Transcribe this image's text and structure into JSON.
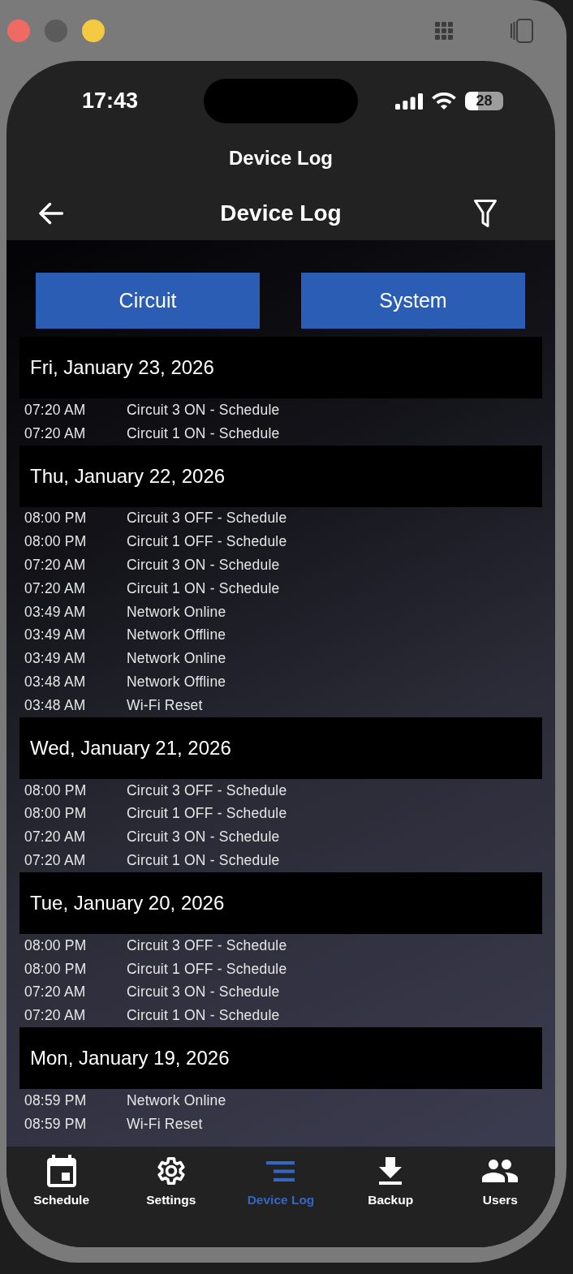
{
  "window": {
    "controls": [
      {
        "color": "#ee6a63"
      },
      {
        "color": "#5b5b5b"
      },
      {
        "color": "#f5c942"
      }
    ]
  },
  "status_bar": {
    "time": "17:43",
    "battery": "28"
  },
  "page_title": "Device Log",
  "nav_bar": {
    "title": "Device Log"
  },
  "categories": [
    {
      "label": "Circuit"
    },
    {
      "label": "System"
    }
  ],
  "log": [
    {
      "date": "Fri, January 23, 2026",
      "entries": [
        {
          "time": "07:20 AM",
          "event": "Circuit 3 ON - Schedule"
        },
        {
          "time": "07:20 AM",
          "event": "Circuit 1 ON - Schedule"
        }
      ]
    },
    {
      "date": "Thu, January 22, 2026",
      "entries": [
        {
          "time": "08:00 PM",
          "event": "Circuit 3 OFF - Schedule"
        },
        {
          "time": "08:00 PM",
          "event": "Circuit 1 OFF - Schedule"
        },
        {
          "time": "07:20 AM",
          "event": "Circuit 3 ON - Schedule"
        },
        {
          "time": "07:20 AM",
          "event": "Circuit 1 ON - Schedule"
        },
        {
          "time": "03:49 AM",
          "event": "Network Online"
        },
        {
          "time": "03:49 AM",
          "event": "Network Offline"
        },
        {
          "time": "03:49 AM",
          "event": "Network Online"
        },
        {
          "time": "03:48 AM",
          "event": "Network Offline"
        },
        {
          "time": "03:48 AM",
          "event": "Wi-Fi Reset"
        }
      ]
    },
    {
      "date": "Wed, January 21, 2026",
      "entries": [
        {
          "time": "08:00 PM",
          "event": "Circuit 3 OFF - Schedule"
        },
        {
          "time": "08:00 PM",
          "event": "Circuit 1 OFF - Schedule"
        },
        {
          "time": "07:20 AM",
          "event": "Circuit 3 ON - Schedule"
        },
        {
          "time": "07:20 AM",
          "event": "Circuit 1 ON - Schedule"
        }
      ]
    },
    {
      "date": "Tue, January 20, 2026",
      "entries": [
        {
          "time": "08:00 PM",
          "event": "Circuit 3 OFF - Schedule"
        },
        {
          "time": "08:00 PM",
          "event": "Circuit 1 OFF - Schedule"
        },
        {
          "time": "07:20 AM",
          "event": "Circuit 3 ON - Schedule"
        },
        {
          "time": "07:20 AM",
          "event": "Circuit 1 ON - Schedule"
        }
      ]
    },
    {
      "date": "Mon, January 19, 2026",
      "entries": [
        {
          "time": "08:59 PM",
          "event": "Network Online"
        },
        {
          "time": "08:59 PM",
          "event": "Wi-Fi Reset"
        }
      ]
    }
  ],
  "tab_bar": [
    {
      "label": "Schedule",
      "selected": false
    },
    {
      "label": "Settings",
      "selected": false
    },
    {
      "label": "Device Log",
      "selected": true
    },
    {
      "label": "Backup",
      "selected": false
    },
    {
      "label": "Users",
      "selected": false
    }
  ]
}
